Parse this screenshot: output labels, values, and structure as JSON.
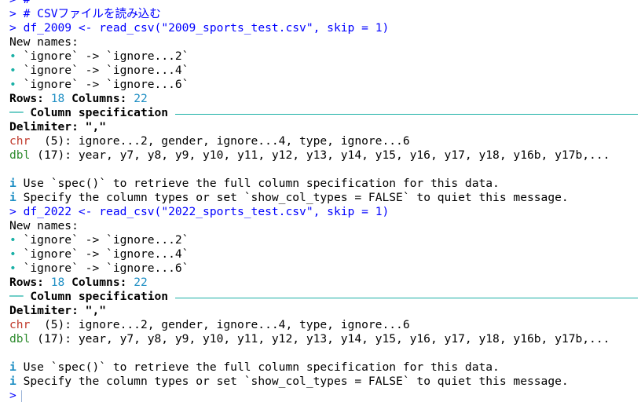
{
  "prompt_symbol": ">",
  "lines": {
    "l0": "#",
    "l1": "# CSVファイルを読み込む",
    "l2": "df_2009 <- read_csv(\"2009_sports_test.csv\", skip = 1)",
    "l3": "New names:",
    "l4": "`ignore` -> `ignore...2`",
    "l5": "`ignore` -> `ignore...4`",
    "l6": "`ignore` -> `ignore...6`",
    "rows_label": "Rows:",
    "rows_value": "18",
    "cols_label": "Columns:",
    "cols_value": "22",
    "spec_header": "Column specification",
    "delimiter_label": "Delimiter:",
    "delimiter_value": "\",\"",
    "chr_type": "chr",
    "chr_cols": "(5): ignore...2, gender, ignore...4, type, ignore...6",
    "dbl_type": "dbl",
    "dbl_cols": "(17): year, y7, y8, y9, y10, y11, y12, y13, y14, y15, y16, y17, y18, y16b, y17b,...",
    "info_icon": "i",
    "info1": "Use `spec()` to retrieve the full column specification for this data.",
    "info2": "Specify the column types or set `show_col_types = FALSE` to quiet this message.",
    "l2b": "df_2022 <- read_csv(\"2022_sports_test.csv\", skip = 1)",
    "bullet": "•",
    "dash": "──"
  },
  "colors": {
    "command": "#0000ff",
    "bullet": "#1ab0a6",
    "number": "#1f8fc4",
    "chr": "#c0392b",
    "dbl": "#2e8b2e",
    "rule": "#1ab0a6"
  }
}
